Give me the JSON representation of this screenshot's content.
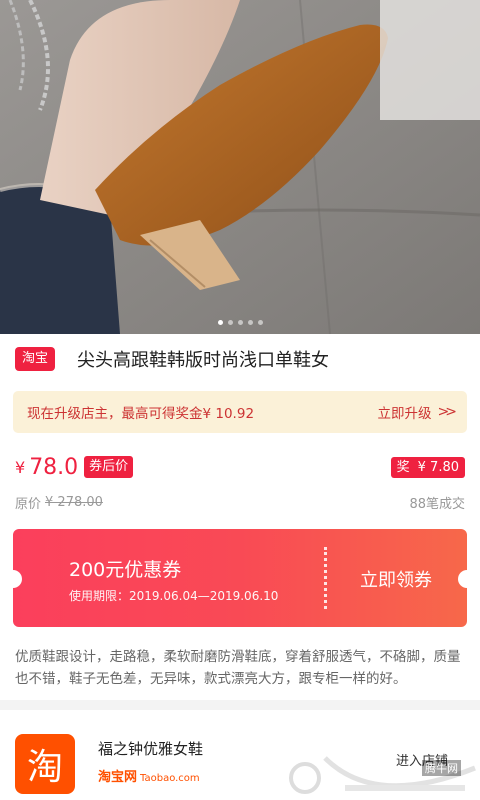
{
  "gallery": {
    "page_count": 5,
    "active_index": 0
  },
  "product": {
    "source_tag": "淘宝",
    "title": "尖头高跟鞋韩版时尚浅口单鞋女",
    "price_currency": "¥",
    "price": "78.0",
    "price_tag": "券后价",
    "reward_label": "奖",
    "reward_value": "¥ 7.80",
    "original_label": "原价",
    "original_price": "¥ 278.00",
    "sold": "88笔成交",
    "description": "优质鞋跟设计，走路稳，柔软耐磨防滑鞋底，穿着舒服透气，不硌脚，质量也不错，鞋子无色差，无异味，款式漂亮大方，跟专柜一样的好。"
  },
  "promo": {
    "text": "现在升级店主，最高可得奖金¥ 10.92",
    "link": "立即升级"
  },
  "coupon": {
    "amount": "200元优惠券",
    "validity": "使用期限：2019.06.04—2019.06.10",
    "claim": "立即领券"
  },
  "shop": {
    "logo_char": "淘",
    "name": "福之钟优雅女鞋",
    "platform_cn": "淘宝网",
    "platform_en": "Taobao.com",
    "enter": "进入店铺"
  },
  "watermark": {
    "brand": "腾牛网"
  },
  "colors": {
    "accent": "#ef2140",
    "promo_bg": "#fbf1d8",
    "taobao": "#ff5000"
  }
}
